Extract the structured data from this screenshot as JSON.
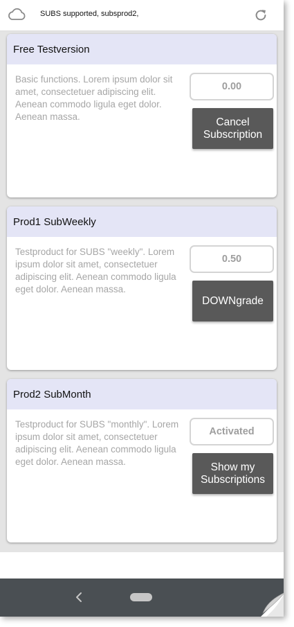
{
  "header": {
    "title": "SUBS supported, subsprod2,",
    "left_icon": "cloud-icon",
    "right_icon": "refresh-icon"
  },
  "products": [
    {
      "title": "Free Testversion",
      "description": "Basic functions. Lorem ipsum dolor sit amet, consectetuer adipiscing elit. Aenean commodo ligula eget dolor. Aenean massa.",
      "price": "0.00",
      "action_label": "Cancel Subscription"
    },
    {
      "title": "Prod1 SubWeekly",
      "description": "Testproduct for SUBS \"weekly\". Lorem ipsum dolor sit amet, consectetuer adipiscing elit. Aenean commodo ligula eget dolor. Aenean massa.",
      "price": "0.50",
      "action_label": "DOWNgrade"
    },
    {
      "title": "Prod2 SubMonth",
      "description": "Testproduct for SUBS \"monthly\". Lorem ipsum dolor sit amet, consectetuer adipiscing elit. Aenean commodo ligula eget dolor. Aenean massa.",
      "price": "Activated",
      "action_label": "Show my Subscriptions"
    }
  ],
  "navbar": {
    "back_icon": "chevron-left-icon",
    "home_icon": "home-pill-icon"
  },
  "colors": {
    "card_header": "#e4e5f6",
    "button": "#595959",
    "navbar": "#4a4f53",
    "list_background": "#e4e4e4"
  }
}
